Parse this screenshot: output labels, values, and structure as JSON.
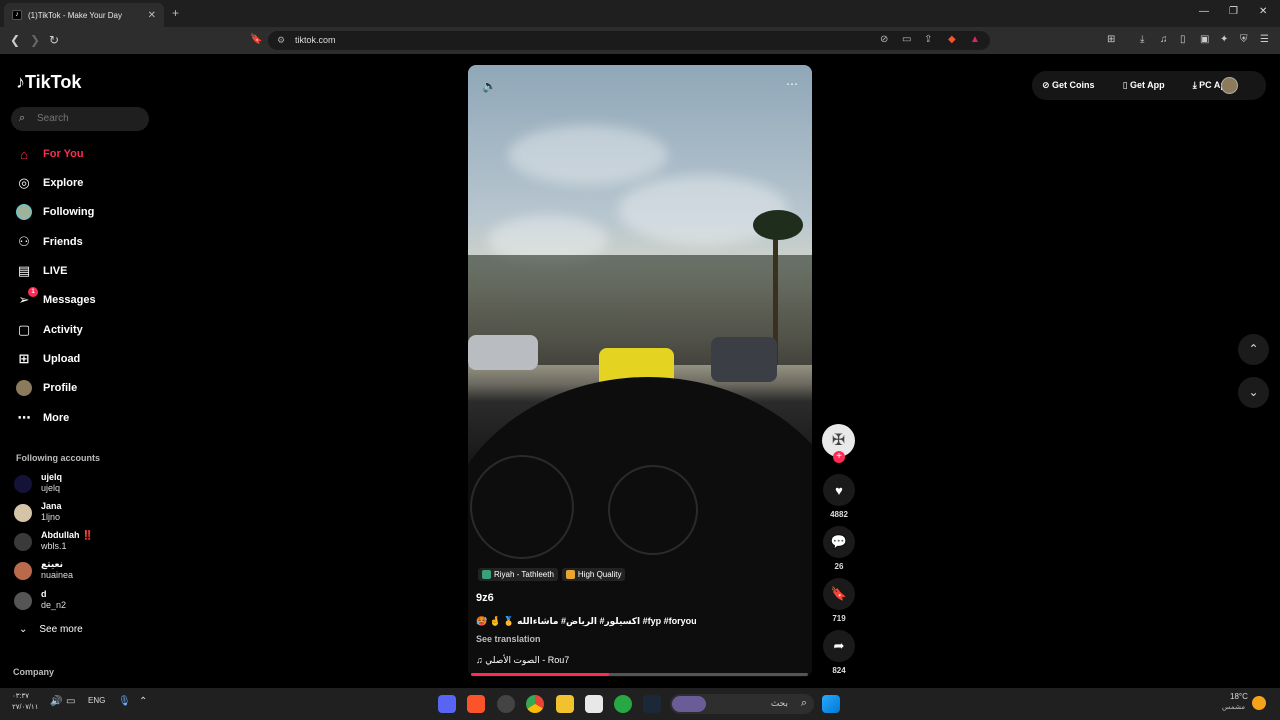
{
  "browser": {
    "tab_title": "(1)TikTok - Make Your Day",
    "tab_close": "✕",
    "new_tab": "+",
    "url": "tiktok.com",
    "window_controls": [
      "—",
      "❐",
      "✕"
    ]
  },
  "sidebar": {
    "logo": "TikTok",
    "search_placeholder": "Search",
    "nav": [
      {
        "label": "For You",
        "icon": "home-icon"
      },
      {
        "label": "Explore",
        "icon": "compass-icon"
      },
      {
        "label": "Following",
        "icon": "following-avatar-icon"
      },
      {
        "label": "Friends",
        "icon": "friends-icon"
      },
      {
        "label": "LIVE",
        "icon": "live-icon"
      },
      {
        "label": "Messages",
        "icon": "messages-icon",
        "badge": "1"
      },
      {
        "label": "Activity",
        "icon": "activity-icon"
      },
      {
        "label": "Upload",
        "icon": "upload-icon"
      },
      {
        "label": "Profile",
        "icon": "profile-icon"
      },
      {
        "label": "More",
        "icon": "more-icon"
      }
    ],
    "following_header": "Following accounts",
    "accounts": [
      {
        "name": "ujelq",
        "user": "ujelq"
      },
      {
        "name": "Jana",
        "user": "1ljno"
      },
      {
        "name": "Abdullah ‼️",
        "user": "wbls.1"
      },
      {
        "name": "نعيتع",
        "user": "nuainea"
      },
      {
        "name": "d",
        "user": "de_n2"
      }
    ],
    "see_more": "See more",
    "company": "Company"
  },
  "video": {
    "tags": [
      {
        "label": "Riyah - Tathleeth",
        "color": "#3aa07a"
      },
      {
        "label": "High Quality",
        "color": "#e8a530"
      }
    ],
    "username": "9z6",
    "description": "🥵 🤞 🥇 اكسيلور# الرياض# ماشاءالله #fyp #foryou",
    "see_translation": "See translation",
    "music": "♫ الصوت الأصلي - Rou7",
    "progress": 0.41
  },
  "actions": {
    "likes": "4882",
    "comments": "26",
    "saves": "719",
    "shares": "824"
  },
  "topright": {
    "get_coins": "Get Coins",
    "get_app": "Get App",
    "pc_app": "PC App"
  },
  "taskbar": {
    "time": "٠٣:٣٧",
    "date": "٢٧/٠٧/١١",
    "lang": "ENG",
    "search_label": "بحث",
    "weather_temp": "18°C",
    "weather_text": "مشمس"
  },
  "colors": {
    "accent": "#fe2c55"
  }
}
